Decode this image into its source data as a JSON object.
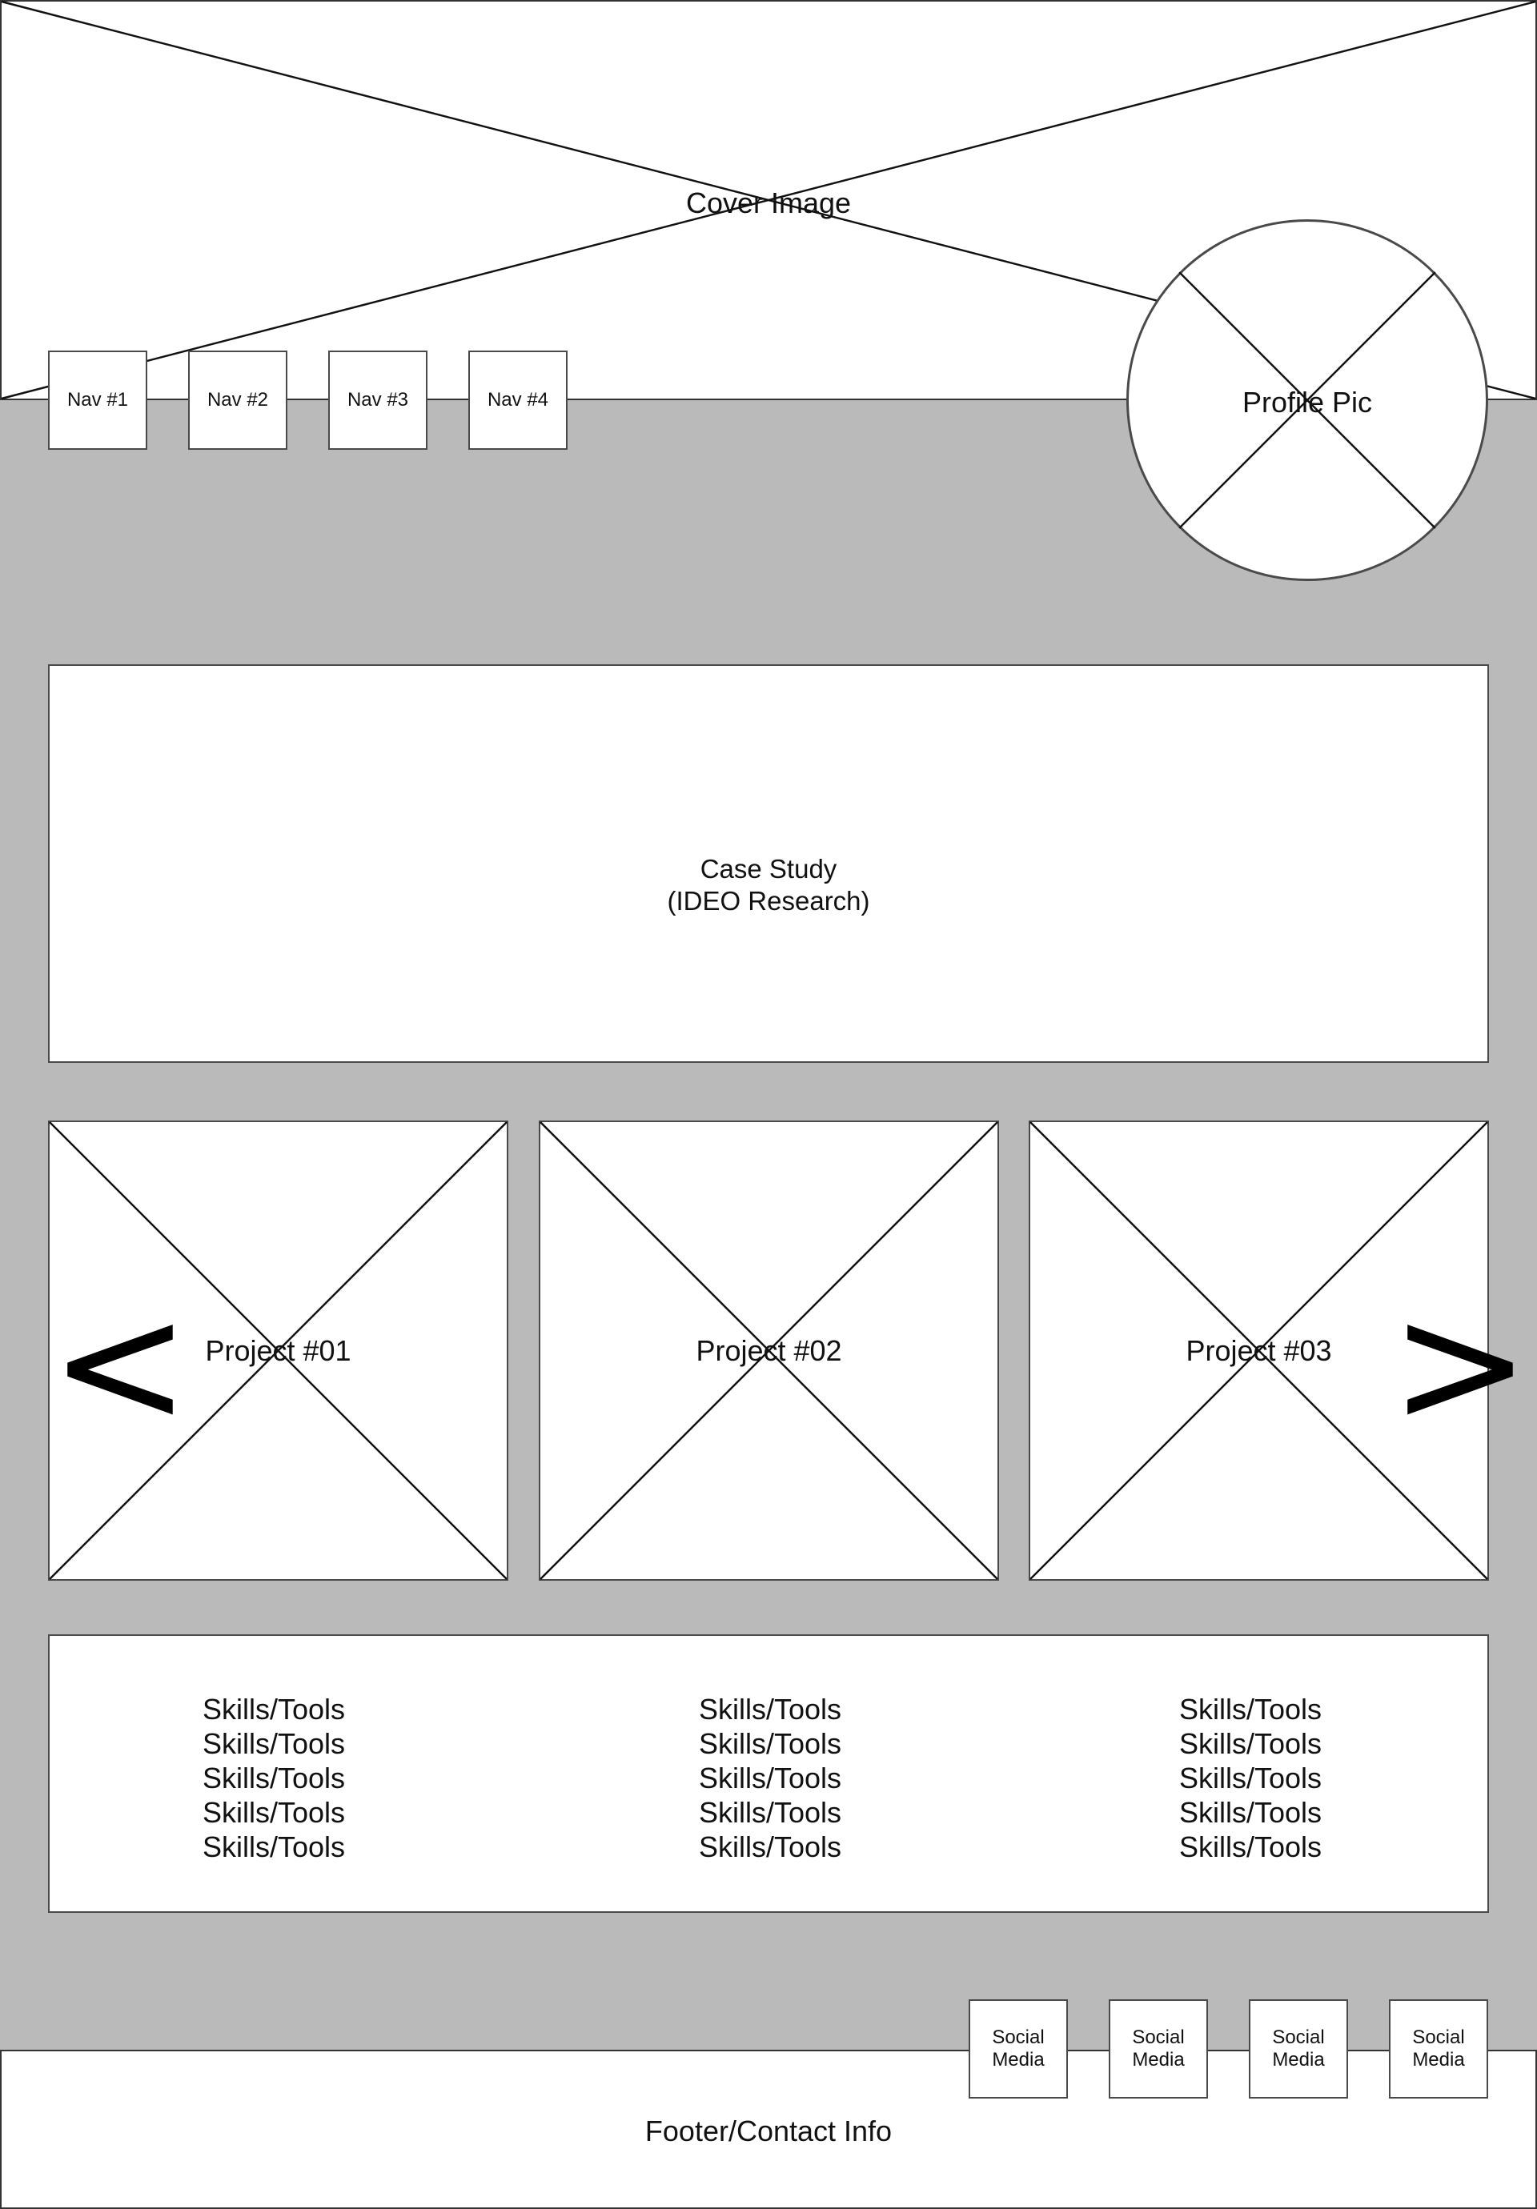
{
  "cover": {
    "label": "Cover Image"
  },
  "nav": {
    "items": [
      "Nav #1",
      "Nav #2",
      "Nav #3",
      "Nav #4"
    ]
  },
  "profile": {
    "label": "Profile Pic"
  },
  "case_study": {
    "line1": "Case Study",
    "line2": "(IDEO Research)"
  },
  "projects": {
    "items": [
      "Project #01",
      "Project #02",
      "Project #03"
    ],
    "prev_label": "<",
    "next_label": ">"
  },
  "skills": {
    "columns": [
      [
        "Skills/Tools",
        "Skills/Tools",
        "Skills/Tools",
        "Skills/Tools",
        "Skills/Tools"
      ],
      [
        "Skills/Tools",
        "Skills/Tools",
        "Skills/Tools",
        "Skills/Tools",
        "Skills/Tools"
      ],
      [
        "Skills/Tools",
        "Skills/Tools",
        "Skills/Tools",
        "Skills/Tools",
        "Skills/Tools"
      ]
    ]
  },
  "social": {
    "items": [
      "Social\nMedia",
      "Social\nMedia",
      "Social\nMedia",
      "Social\nMedia"
    ]
  },
  "footer": {
    "label": "Footer/Contact Info"
  },
  "colors": {
    "background": "#bababa",
    "panel": "#ffffff",
    "border": "#4a4a4a"
  }
}
